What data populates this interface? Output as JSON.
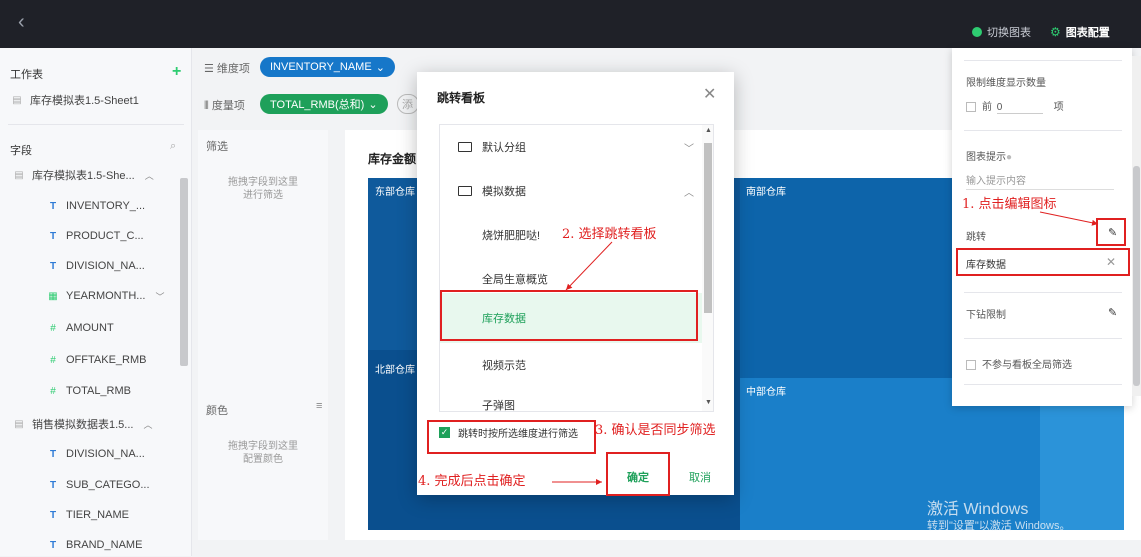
{
  "topbar": {
    "back": "‹",
    "switch_chart": "切换图表",
    "chart_config": "图表配置"
  },
  "left": {
    "worksheet_label": "工作表",
    "sheet_name": "库存模拟表1.5-Sheet1",
    "fields_label": "字段",
    "group1": "库存模拟表1.5-She...",
    "group1_fields": [
      {
        "type": "T",
        "name": "INVENTORY_..."
      },
      {
        "type": "T",
        "name": "PRODUCT_C..."
      },
      {
        "type": "T",
        "name": "DIVISION_NA..."
      },
      {
        "type": "date",
        "name": "YEARMONTH..."
      },
      {
        "type": "#",
        "name": "AMOUNT"
      },
      {
        "type": "#",
        "name": "OFFTAKE_RMB"
      },
      {
        "type": "#",
        "name": "TOTAL_RMB"
      }
    ],
    "group2": "销售模拟数据表1.5...",
    "group2_fields": [
      {
        "type": "T",
        "name": "DIVISION_NA..."
      },
      {
        "type": "T",
        "name": "SUB_CATEGO..."
      },
      {
        "type": "T",
        "name": "TIER_NAME"
      },
      {
        "type": "T",
        "name": "BRAND_NAME"
      }
    ]
  },
  "shelf": {
    "dimension_label": "维度项",
    "dimension_value": "INVENTORY_NAME",
    "measure_label": "度量项",
    "measure_value": "TOTAL_RMB(总和)",
    "add_label": "添"
  },
  "filter": {
    "label": "筛选",
    "hint_line1": "拖拽字段到这里",
    "hint_line2": "进行筛选"
  },
  "color": {
    "label": "颜色",
    "hint_line1": "拖拽字段到这里",
    "hint_line2": "配置颜色"
  },
  "chart": {
    "title_partial": "库存金额",
    "tiles": [
      "东部仓库",
      "南部仓库",
      "北部仓库",
      "中部仓库"
    ],
    "tile_colors": [
      "#0f5a9c",
      "#0d64aa",
      "#0a4f8e",
      "#1a7fc9"
    ]
  },
  "watermark": {
    "line1": "激活 Windows",
    "line2": "转到\"设置\"以激活 Windows。"
  },
  "right_panel": {
    "limit_label": "限制维度显示数量",
    "top_label": "前",
    "top_value": "0",
    "top_unit": "项",
    "tooltip_label": "图表提示",
    "tooltip_placeholder": "输入提示内容",
    "jump_label": "跳转",
    "jump_target": "库存数据",
    "drill_label": "下钻限制",
    "no_global_filter": "不参与看板全局筛选"
  },
  "modal": {
    "title": "跳转看板",
    "items": [
      {
        "kind": "folder",
        "label": "默认分组"
      },
      {
        "kind": "folder",
        "label": "模拟数据"
      },
      {
        "kind": "board",
        "label": "烧饼肥肥哒!"
      },
      {
        "kind": "board",
        "label": "全局生意概览"
      },
      {
        "kind": "board",
        "label": "库存数据"
      },
      {
        "kind": "board",
        "label": "视频示范"
      },
      {
        "kind": "board",
        "label": "子弹图"
      }
    ],
    "sync_filter": "跳转时按所选维度进行筛选",
    "ok": "确定",
    "cancel": "取消"
  },
  "annotations": {
    "step1": "1. 点击编辑图标",
    "step2": "2. 选择跳转看板",
    "step3": "3. 确认是否同步筛选",
    "step4": "4. 完成后点击确定"
  },
  "colors": {
    "accent_green": "#1ea05a",
    "accent_blue": "#1677c9",
    "annotation_red": "#e02020"
  }
}
